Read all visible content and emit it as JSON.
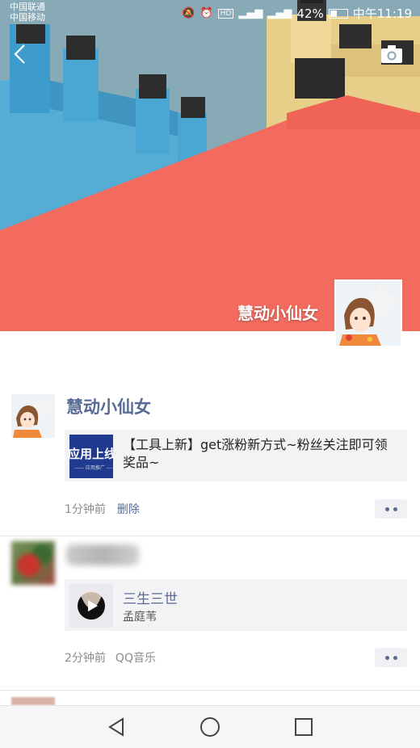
{
  "status_bar": {
    "carrier_1": "中国联通",
    "carrier_2": "中国移动",
    "battery": "42%",
    "time": "中午11:19",
    "icons": [
      "mute-icon",
      "alarm-icon",
      "hd-icon",
      "signal-icon",
      "battery-icon"
    ]
  },
  "header": {
    "back_icon": "back-arrow-icon",
    "camera_icon": "camera-icon"
  },
  "profile": {
    "name": "慧动小仙女"
  },
  "posts": [
    {
      "author": "慧动小仙女",
      "link": {
        "thumb_text": "应用上线",
        "thumb_subtext": "—— 应用推广 ——",
        "title": "【工具上新】get涨粉新方式~粉丝关注即可领奖品~"
      },
      "time": "1分钟前",
      "action": "删除"
    },
    {
      "author_blurred": true,
      "music": {
        "title": "三生三世",
        "artist": "孟庭苇"
      },
      "time": "2分钟前",
      "source": "QQ音乐"
    }
  ],
  "colors": {
    "link_blue": "#576b95",
    "cover_red": "#f26b5e",
    "cover_blue": "#59b0d9",
    "card_bg": "#f3f3f5"
  },
  "navbar": {
    "icons": [
      "nav-back-icon",
      "nav-home-icon",
      "nav-recents-icon"
    ]
  }
}
